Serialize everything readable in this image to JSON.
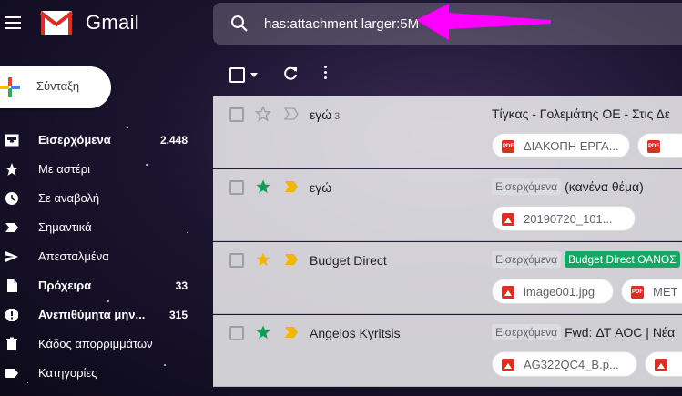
{
  "app": {
    "brand": "Gmail"
  },
  "search": {
    "value": "has:attachment larger:5M"
  },
  "compose": {
    "label": "Σύνταξη"
  },
  "nav": [
    {
      "label": "Εισερχόμενα",
      "count": "2.448",
      "bold": true,
      "icon": "inbox-icon"
    },
    {
      "label": "Με αστέρι",
      "count": "",
      "bold": false,
      "icon": "star-icon"
    },
    {
      "label": "Σε αναβολή",
      "count": "",
      "bold": false,
      "icon": "clock-icon"
    },
    {
      "label": "Σημαντικά",
      "count": "",
      "bold": false,
      "icon": "important-icon"
    },
    {
      "label": "Απεσταλμένα",
      "count": "",
      "bold": false,
      "icon": "send-icon"
    },
    {
      "label": "Πρόχειρα",
      "count": "33",
      "bold": true,
      "icon": "draft-icon"
    },
    {
      "label": "Ανεπιθύμητα μην...",
      "count": "315",
      "bold": true,
      "icon": "spam-icon"
    },
    {
      "label": "Κάδος απορριμμάτων",
      "count": "",
      "bold": false,
      "icon": "trash-icon"
    },
    {
      "label": "Κατηγορίες",
      "count": "",
      "bold": false,
      "icon": "label-icon"
    }
  ],
  "emails": [
    {
      "sender": "εγώ",
      "thread_count": "3",
      "starred": false,
      "important": false,
      "tags": [],
      "subject": "Τίγκας - Γολεμάτης ΟΕ - Στις Δε",
      "attachments": [
        {
          "name": "ΔΙΑΚΟΠΗ ΕΡΓΑ...",
          "type": "pdf"
        },
        {
          "name": "",
          "type": "pdf"
        }
      ]
    },
    {
      "sender": "εγώ",
      "thread_count": "",
      "starred": true,
      "important": true,
      "tags": [
        {
          "text": "Εισερχόμενα",
          "color": "#dadce0"
        }
      ],
      "subject": "(κανένα θέμα)",
      "attachments": [
        {
          "name": "20190720_101...",
          "type": "image"
        }
      ]
    },
    {
      "sender": "Budget Direct",
      "thread_count": "",
      "starred": true,
      "important": true,
      "tags": [
        {
          "text": "Εισερχόμενα",
          "color": "#dadce0"
        },
        {
          "text": "Budget Direct ΘΑΝΟΣ",
          "color": "#16a765"
        }
      ],
      "subject": "",
      "attachments": [
        {
          "name": "image001.jpg",
          "type": "image"
        },
        {
          "name": "ΜΕΤ",
          "type": "pdf"
        }
      ]
    },
    {
      "sender": "Angelos Kyritsis",
      "thread_count": "",
      "starred": true,
      "important": true,
      "tags": [
        {
          "text": "Εισερχόμενα",
          "color": "#dadce0"
        }
      ],
      "subject": "Fwd: ΔΤ AOC | Νέα",
      "attachments": [
        {
          "name": "AG322QC4_B.p...",
          "type": "image"
        },
        {
          "name": "",
          "type": "image"
        }
      ]
    }
  ],
  "colors": {
    "star_yellow": "#f4b400",
    "star_green": "#0f9d58",
    "important_yellow": "#f4b400",
    "gmail_red": "#d93025",
    "annotation_arrow": "#ff00ff"
  }
}
